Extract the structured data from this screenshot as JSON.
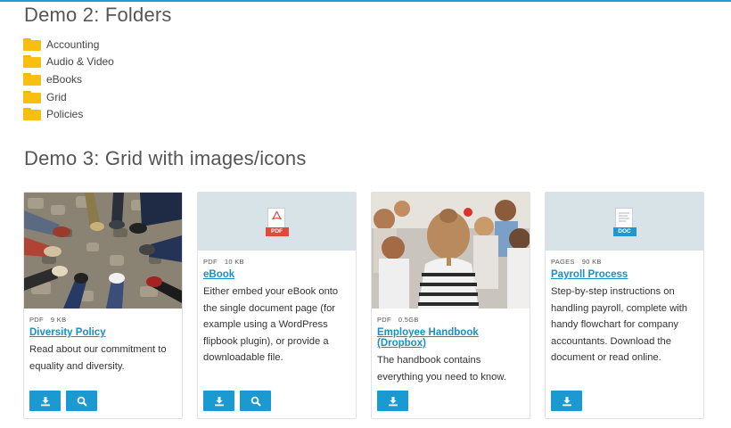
{
  "demo2": {
    "heading": "Demo 2: Folders",
    "folders": [
      "Accounting",
      "Audio & Video",
      "eBooks",
      "Grid",
      "Policies"
    ]
  },
  "demo3": {
    "heading": "Demo 3: Grid with images/icons",
    "cards": [
      {
        "type": "PDF",
        "size": "9 KB",
        "title": "Diversity Policy",
        "description": "Read about our commitment to equality and diversity.",
        "buttons": [
          "download-icon",
          "search-icon"
        ]
      },
      {
        "type": "PDF",
        "size": "10 KB",
        "title": "eBook",
        "description": "Either embed your eBook onto the single document page (for example using a WordPress flipbook plugin), or provide a downloadable file.",
        "icon_badge": "PDF",
        "buttons": [
          "download-icon",
          "search-icon"
        ]
      },
      {
        "type": "PDF",
        "size": "0.5GB",
        "title": "Employee Handbook (Dropbox)",
        "description": "The handbook contains everything you need to know.",
        "buttons": [
          "download-icon"
        ]
      },
      {
        "type": "PAGES",
        "size": "90 KB",
        "title": "Payroll Process",
        "description": "Step-by-step instructions on handling payroll, complete with handy flowchart for company accountants. Download the document or read online.",
        "icon_badge": "DOC",
        "buttons": [
          "download-icon"
        ]
      }
    ]
  },
  "colors": {
    "accent": "#1a9ad0",
    "folder": "#f9be12",
    "pdf_badge": "#e04a3a",
    "doc_badge": "#2196d3"
  }
}
